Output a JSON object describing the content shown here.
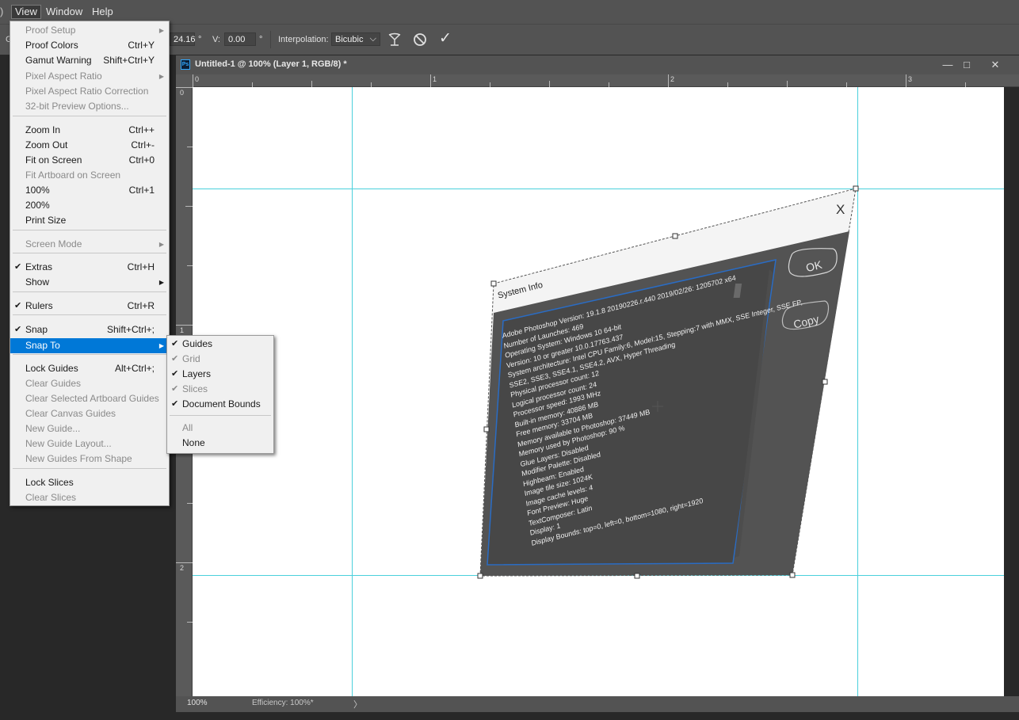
{
  "menubar": {
    "items": [
      {
        "label": "View"
      },
      {
        "label": "Window"
      },
      {
        "label": "Help"
      }
    ]
  },
  "options_bar": {
    "rotate_value": "24.16",
    "rotate_unit": "°",
    "v_skew_label": "V:",
    "v_skew_value": "0.00",
    "v_skew_unit": "°",
    "interpolation_label": "Interpolation:",
    "interpolation_value": "Bicubic",
    "interpolation_arrow": "⌵",
    "commit_glyph": "✓"
  },
  "document": {
    "tab_title": "Untitled-1 @ 100% (Layer 1, RGB/8) *",
    "ps_badge": "Ps",
    "window_controls": [
      "—",
      "□",
      "✕"
    ],
    "ruler_h_labels": [
      "0",
      "1",
      "2",
      "3"
    ],
    "ruler_v_labels": [
      "0",
      "1",
      "2"
    ],
    "zoom": "100%",
    "status": "Efficiency: 100%*",
    "status_arrow": "〉"
  },
  "transformed_layer": {
    "title": "System Info",
    "close_glyph": "X",
    "ok_label": "OK",
    "copy_label": "Copy",
    "info_lines": [
      "Adobe Photoshop Version: 19.1.8 20190226.r.440 2019/02/26: 1205702 x64",
      "Number of Launches: 469",
      "Operating System: Windows 10 64-bit",
      "Version: 10 or greater 10.0.17763.437",
      "System architecture: Intel CPU Family:6, Model:15, Stepping:7 with MMX, SSE Integer, SSE FP,",
      "SSE2, SSE3, SSE4.1, SSE4.2, AVX, Hyper Threading",
      "Physical processor count: 12",
      "Logical processor count: 24",
      "Processor speed: 1993 MHz",
      "Built-in memory: 40886 MB",
      "Free memory: 33704 MB",
      "Memory available to Photoshop: 37449 MB",
      "Memory used by Photoshop: 90 %",
      "Glue Layers: Disabled",
      "Modifier Palette: Disabled",
      "Highbeam: Enabled",
      "Image tile size: 1024K",
      "Image cache levels: 4",
      "Font Preview: Huge",
      "TextComposer: Latin",
      "Display: 1",
      "Display Bounds: top=0, left=0, bottom=1080, right=1920"
    ]
  },
  "view_menu": {
    "items": [
      {
        "label": "Proof Setup",
        "shortcut": "",
        "check": false,
        "submenu": true,
        "disabled": true
      },
      {
        "label": "Proof Colors",
        "shortcut": "Ctrl+Y",
        "check": false,
        "submenu": false,
        "disabled": false
      },
      {
        "label": "Gamut Warning",
        "shortcut": "Shift+Ctrl+Y",
        "check": false,
        "submenu": false,
        "disabled": false
      },
      {
        "label": "Pixel Aspect Ratio",
        "shortcut": "",
        "check": false,
        "submenu": true,
        "disabled": true
      },
      {
        "label": "Pixel Aspect Ratio Correction",
        "shortcut": "",
        "check": false,
        "submenu": false,
        "disabled": true
      },
      {
        "label": "32-bit Preview Options...",
        "shortcut": "",
        "check": false,
        "submenu": false,
        "disabled": true
      },
      {
        "label": "Zoom In",
        "shortcut": "Ctrl++",
        "check": false,
        "submenu": false,
        "disabled": false
      },
      {
        "label": "Zoom Out",
        "shortcut": "Ctrl+-",
        "check": false,
        "submenu": false,
        "disabled": false
      },
      {
        "label": "Fit on Screen",
        "shortcut": "Ctrl+0",
        "check": false,
        "submenu": false,
        "disabled": false
      },
      {
        "label": "Fit Artboard on Screen",
        "shortcut": "",
        "check": false,
        "submenu": false,
        "disabled": true
      },
      {
        "label": "100%",
        "shortcut": "Ctrl+1",
        "check": false,
        "submenu": false,
        "disabled": false
      },
      {
        "label": "200%",
        "shortcut": "",
        "check": false,
        "submenu": false,
        "disabled": false
      },
      {
        "label": "Print Size",
        "shortcut": "",
        "check": false,
        "submenu": false,
        "disabled": false
      },
      {
        "label": "Screen Mode",
        "shortcut": "",
        "check": false,
        "submenu": true,
        "disabled": true
      },
      {
        "label": "Extras",
        "shortcut": "Ctrl+H",
        "check": true,
        "submenu": false,
        "disabled": false
      },
      {
        "label": "Show",
        "shortcut": "",
        "check": false,
        "submenu": true,
        "disabled": false
      },
      {
        "label": "Rulers",
        "shortcut": "Ctrl+R",
        "check": true,
        "submenu": false,
        "disabled": false
      },
      {
        "label": "Snap",
        "shortcut": "Shift+Ctrl+;",
        "check": true,
        "submenu": false,
        "disabled": false
      },
      {
        "label": "Snap To",
        "shortcut": "",
        "check": false,
        "submenu": true,
        "disabled": false,
        "highlighted": true
      },
      {
        "label": "Lock Guides",
        "shortcut": "Alt+Ctrl+;",
        "check": false,
        "submenu": false,
        "disabled": false
      },
      {
        "label": "Clear Guides",
        "shortcut": "",
        "check": false,
        "submenu": false,
        "disabled": true
      },
      {
        "label": "Clear Selected Artboard Guides",
        "shortcut": "",
        "check": false,
        "submenu": false,
        "disabled": true
      },
      {
        "label": "Clear Canvas Guides",
        "shortcut": "",
        "check": false,
        "submenu": false,
        "disabled": true
      },
      {
        "label": "New Guide...",
        "shortcut": "",
        "check": false,
        "submenu": false,
        "disabled": true
      },
      {
        "label": "New Guide Layout...",
        "shortcut": "",
        "check": false,
        "submenu": false,
        "disabled": true
      },
      {
        "label": "New Guides From Shape",
        "shortcut": "",
        "check": false,
        "submenu": false,
        "disabled": true
      },
      {
        "label": "Lock Slices",
        "shortcut": "",
        "check": false,
        "submenu": false,
        "disabled": false
      },
      {
        "label": "Clear Slices",
        "shortcut": "",
        "check": false,
        "submenu": false,
        "disabled": true
      }
    ]
  },
  "snap_to_menu": {
    "items": [
      {
        "label": "Guides",
        "check": true,
        "disabled": false
      },
      {
        "label": "Grid",
        "check": true,
        "disabled": true
      },
      {
        "label": "Layers",
        "check": true,
        "disabled": false
      },
      {
        "label": "Slices",
        "check": true,
        "disabled": true
      },
      {
        "label": "Document Bounds",
        "check": true,
        "disabled": false
      },
      {
        "label": "All",
        "check": false,
        "disabled": true
      },
      {
        "label": "None",
        "check": false,
        "disabled": false
      }
    ]
  },
  "glyphs": {
    "check": "✔",
    "submenu_arrow": "▶"
  }
}
